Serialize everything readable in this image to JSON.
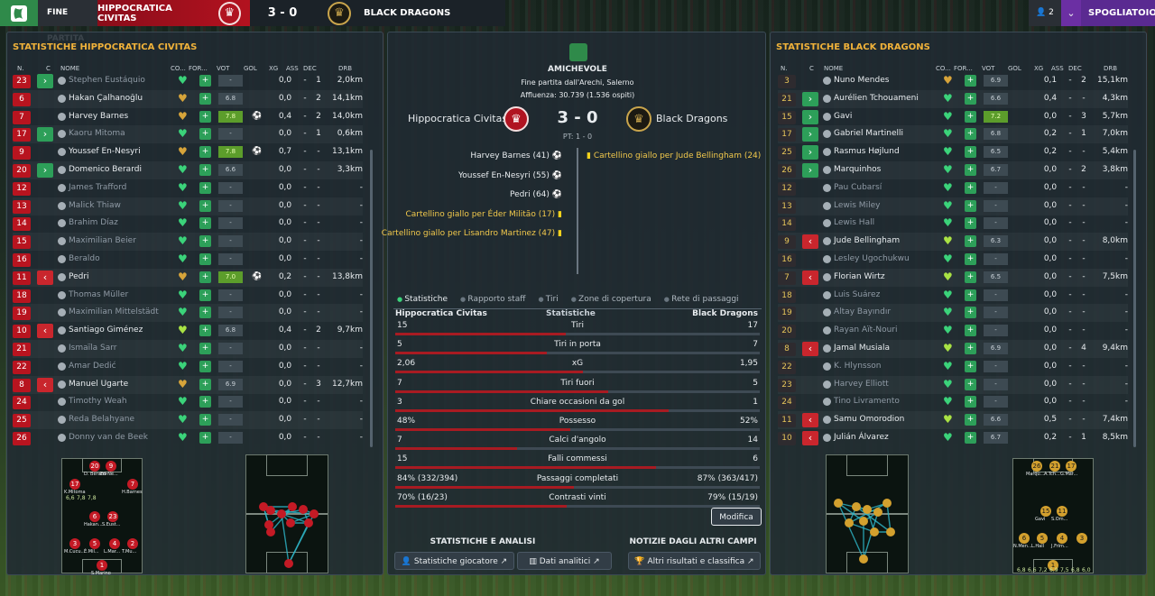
{
  "topbar": {
    "status": "FINE PARTITA",
    "home_team": "HIPPOCRATICA CIVITAS",
    "score": "3 - 0",
    "away_team": "BLACK DRAGONS",
    "notif_count": "2",
    "dressing_room": "SPOGLIATOIO"
  },
  "home": {
    "title": "STATISTICHE HIPPOCRATICA CIVITAS",
    "headers": {
      "n": "N.",
      "c": "C",
      "nome": "NOME",
      "co": "CO...",
      "for": "FOR...",
      "vot": "VOT",
      "gol": "GOL",
      "xg": "XG",
      "ass": "ASS",
      "dec": "DEC",
      "drb": "DRB"
    },
    "players": [
      {
        "n": "23",
        "sub": "in",
        "name": "Stephen Eustáquio",
        "cond": "green",
        "vot": "-",
        "goal": "",
        "xg": "0,0",
        "ass": "-",
        "dec": "1",
        "drb": "2,0km"
      },
      {
        "n": "6",
        "sub": "",
        "name": "Hakan Çalhanoğlu",
        "cond": "gold",
        "vot": "6.8",
        "goal": "",
        "xg": "0,0",
        "ass": "-",
        "dec": "2",
        "drb": "14,1km"
      },
      {
        "n": "7",
        "sub": "",
        "name": "Harvey Barnes",
        "cond": "gold",
        "vot": "7.8",
        "goal": "⚽",
        "xg": "0,4",
        "ass": "-",
        "dec": "2",
        "drb": "14,0km"
      },
      {
        "n": "17",
        "sub": "in",
        "name": "Kaoru Mitoma",
        "cond": "green",
        "vot": "-",
        "goal": "",
        "xg": "0,0",
        "ass": "-",
        "dec": "1",
        "drb": "0,6km"
      },
      {
        "n": "9",
        "sub": "",
        "name": "Youssef En-Nesyri",
        "cond": "gold",
        "vot": "7.8",
        "goal": "⚽",
        "xg": "0,7",
        "ass": "-",
        "dec": "-",
        "drb": "13,1km"
      },
      {
        "n": "20",
        "sub": "in",
        "name": "Domenico Berardi",
        "cond": "green",
        "vot": "6.6",
        "goal": "",
        "xg": "0,0",
        "ass": "-",
        "dec": "-",
        "drb": "3,3km"
      },
      {
        "n": "12",
        "sub": "",
        "name": "James Trafford",
        "cond": "green",
        "vot": "-",
        "goal": "",
        "xg": "0,0",
        "ass": "-",
        "dec": "-",
        "drb": "-"
      },
      {
        "n": "13",
        "sub": "",
        "name": "Malick Thiaw",
        "cond": "green",
        "vot": "-",
        "goal": "",
        "xg": "0,0",
        "ass": "-",
        "dec": "-",
        "drb": "-"
      },
      {
        "n": "14",
        "sub": "",
        "name": "Brahim Díaz",
        "cond": "green",
        "vot": "-",
        "goal": "",
        "xg": "0,0",
        "ass": "-",
        "dec": "-",
        "drb": "-"
      },
      {
        "n": "15",
        "sub": "",
        "name": "Maximilian Beier",
        "cond": "green",
        "vot": "-",
        "goal": "",
        "xg": "0,0",
        "ass": "-",
        "dec": "-",
        "drb": "-"
      },
      {
        "n": "16",
        "sub": "",
        "name": "Beraldo",
        "cond": "green",
        "vot": "-",
        "goal": "",
        "xg": "0,0",
        "ass": "-",
        "dec": "-",
        "drb": "-"
      },
      {
        "n": "11",
        "sub": "out",
        "name": "Pedri",
        "cond": "gold",
        "vot": "7.0",
        "goal": "⚽",
        "xg": "0,2",
        "ass": "-",
        "dec": "-",
        "drb": "13,8km"
      },
      {
        "n": "18",
        "sub": "",
        "name": "Thomas Müller",
        "cond": "green",
        "vot": "-",
        "goal": "",
        "xg": "0,0",
        "ass": "-",
        "dec": "-",
        "drb": "-"
      },
      {
        "n": "19",
        "sub": "",
        "name": "Maximilian Mittelstädt",
        "cond": "green",
        "vot": "-",
        "goal": "",
        "xg": "0,0",
        "ass": "-",
        "dec": "-",
        "drb": "-"
      },
      {
        "n": "10",
        "sub": "out",
        "name": "Santiago Giménez",
        "cond": "lime",
        "vot": "6.8",
        "goal": "",
        "xg": "0,4",
        "ass": "-",
        "dec": "2",
        "drb": "9,7km"
      },
      {
        "n": "21",
        "sub": "",
        "name": "Ismaïla Sarr",
        "cond": "green",
        "vot": "-",
        "goal": "",
        "xg": "0,0",
        "ass": "-",
        "dec": "-",
        "drb": "-"
      },
      {
        "n": "22",
        "sub": "",
        "name": "Amar Dedić",
        "cond": "green",
        "vot": "-",
        "goal": "",
        "xg": "0,0",
        "ass": "-",
        "dec": "-",
        "drb": "-"
      },
      {
        "n": "8",
        "sub": "out",
        "name": "Manuel Ugarte",
        "cond": "gold",
        "vot": "6.9",
        "goal": "",
        "xg": "0,0",
        "ass": "-",
        "dec": "3",
        "drb": "12,7km"
      },
      {
        "n": "24",
        "sub": "",
        "name": "Timothy Weah",
        "cond": "green",
        "vot": "-",
        "goal": "",
        "xg": "0,0",
        "ass": "-",
        "dec": "-",
        "drb": "-"
      },
      {
        "n": "25",
        "sub": "",
        "name": "Reda Belahyane",
        "cond": "green",
        "vot": "-",
        "goal": "",
        "xg": "0,0",
        "ass": "-",
        "dec": "-",
        "drb": "-"
      },
      {
        "n": "26",
        "sub": "",
        "name": "Donny van de Beek",
        "cond": "green",
        "vot": "-",
        "goal": "",
        "xg": "0,0",
        "ass": "-",
        "dec": "-",
        "drb": "-"
      }
    ]
  },
  "away": {
    "title": "STATISTICHE BLACK DRAGONS",
    "headers": {
      "n": "N.",
      "c": "C",
      "nome": "NOME",
      "co": "CO...",
      "for": "FOR...",
      "vot": "VOT",
      "gol": "GOL",
      "xg": "XG",
      "ass": "ASS",
      "dec": "DEC",
      "drb": "DRB"
    },
    "players": [
      {
        "n": "3",
        "sub": "",
        "name": "Nuno Mendes",
        "cond": "gold",
        "vot": "6.9",
        "goal": "",
        "xg": "0,1",
        "ass": "-",
        "dec": "2",
        "drb": "15,1km"
      },
      {
        "n": "21",
        "sub": "in",
        "name": "Aurélien Tchouameni",
        "cond": "green",
        "vot": "6.6",
        "goal": "",
        "xg": "0,4",
        "ass": "-",
        "dec": "-",
        "drb": "4,3km"
      },
      {
        "n": "15",
        "sub": "in",
        "name": "Gavi",
        "cond": "green",
        "vot": "7.2",
        "goal": "",
        "xg": "0,0",
        "ass": "-",
        "dec": "3",
        "drb": "5,7km"
      },
      {
        "n": "17",
        "sub": "in",
        "name": "Gabriel Martinelli",
        "cond": "green",
        "vot": "6.8",
        "goal": "",
        "xg": "0,2",
        "ass": "-",
        "dec": "1",
        "drb": "7,0km"
      },
      {
        "n": "25",
        "sub": "in",
        "name": "Rasmus Højlund",
        "cond": "green",
        "vot": "6.5",
        "goal": "",
        "xg": "0,2",
        "ass": "-",
        "dec": "-",
        "drb": "5,4km"
      },
      {
        "n": "26",
        "sub": "in",
        "name": "Marquinhos",
        "cond": "green",
        "vot": "6.7",
        "goal": "",
        "xg": "0,0",
        "ass": "-",
        "dec": "2",
        "drb": "3,8km"
      },
      {
        "n": "12",
        "sub": "",
        "name": "Pau Cubarsí",
        "cond": "green",
        "vot": "-",
        "goal": "",
        "xg": "0,0",
        "ass": "-",
        "dec": "-",
        "drb": "-"
      },
      {
        "n": "13",
        "sub": "",
        "name": "Lewis Miley",
        "cond": "green",
        "vot": "-",
        "goal": "",
        "xg": "0,0",
        "ass": "-",
        "dec": "-",
        "drb": "-"
      },
      {
        "n": "14",
        "sub": "",
        "name": "Lewis Hall",
        "cond": "green",
        "vot": "-",
        "goal": "",
        "xg": "0,0",
        "ass": "-",
        "dec": "-",
        "drb": "-"
      },
      {
        "n": "9",
        "sub": "out",
        "name": "Jude Bellingham",
        "cond": "lime",
        "vot": "6.3",
        "goal": "",
        "xg": "0,0",
        "ass": "-",
        "dec": "-",
        "drb": "8,0km"
      },
      {
        "n": "16",
        "sub": "",
        "name": "Lesley Ugochukwu",
        "cond": "green",
        "vot": "-",
        "goal": "",
        "xg": "0,0",
        "ass": "-",
        "dec": "-",
        "drb": "-"
      },
      {
        "n": "7",
        "sub": "out",
        "name": "Florian Wirtz",
        "cond": "lime",
        "vot": "6.5",
        "goal": "",
        "xg": "0,0",
        "ass": "-",
        "dec": "-",
        "drb": "7,5km"
      },
      {
        "n": "18",
        "sub": "",
        "name": "Luis Suárez",
        "cond": "green",
        "vot": "-",
        "goal": "",
        "xg": "0,0",
        "ass": "-",
        "dec": "-",
        "drb": "-"
      },
      {
        "n": "19",
        "sub": "",
        "name": "Altay Bayındır",
        "cond": "green",
        "vot": "-",
        "goal": "",
        "xg": "0,0",
        "ass": "-",
        "dec": "-",
        "drb": "-"
      },
      {
        "n": "20",
        "sub": "",
        "name": "Rayan Aït-Nouri",
        "cond": "green",
        "vot": "-",
        "goal": "",
        "xg": "0,0",
        "ass": "-",
        "dec": "-",
        "drb": "-"
      },
      {
        "n": "8",
        "sub": "out",
        "name": "Jamal Musiala",
        "cond": "lime",
        "vot": "6.9",
        "goal": "",
        "xg": "0,0",
        "ass": "-",
        "dec": "4",
        "drb": "9,4km"
      },
      {
        "n": "22",
        "sub": "",
        "name": "K. Hlynsson",
        "cond": "green",
        "vot": "-",
        "goal": "",
        "xg": "0,0",
        "ass": "-",
        "dec": "-",
        "drb": "-"
      },
      {
        "n": "23",
        "sub": "",
        "name": "Harvey Elliott",
        "cond": "green",
        "vot": "-",
        "goal": "",
        "xg": "0,0",
        "ass": "-",
        "dec": "-",
        "drb": "-"
      },
      {
        "n": "24",
        "sub": "",
        "name": "Tino Livramento",
        "cond": "green",
        "vot": "-",
        "goal": "",
        "xg": "0,0",
        "ass": "-",
        "dec": "-",
        "drb": "-"
      },
      {
        "n": "11",
        "sub": "out",
        "name": "Samu Omorodion",
        "cond": "lime",
        "vot": "6.6",
        "goal": "",
        "xg": "0,5",
        "ass": "-",
        "dec": "-",
        "drb": "7,4km"
      },
      {
        "n": "10",
        "sub": "out",
        "name": "Julián Álvarez",
        "cond": "green",
        "vot": "6.7",
        "goal": "",
        "xg": "0,2",
        "ass": "-",
        "dec": "1",
        "drb": "8,5km"
      }
    ]
  },
  "match": {
    "competition": "AMICHEVOLE",
    "stadium": "Fine partita dall'Arechi, Salerno",
    "attendance": "Affluenza: 30.739 (1.536 ospiti)",
    "home": "Hippocratica Civitas",
    "away": "Black Dragons",
    "score": "3 - 0",
    "halftime": "PT: 1 - 0",
    "home_events": [
      {
        "text": "Harvey Barnes (41)",
        "type": "goal"
      },
      {
        "text": "Youssef En-Nesyri (55)",
        "type": "goal"
      },
      {
        "text": "Pedri (64)",
        "type": "goal"
      },
      {
        "text": "Cartellino giallo per Éder Militão (17)",
        "type": "yellow"
      },
      {
        "text": "Cartellino giallo per Lisandro Martinez (47)",
        "type": "yellow"
      }
    ],
    "away_events": [
      {
        "text": "Cartellino giallo per Jude Bellingham (24)",
        "type": "yellow"
      }
    ]
  },
  "tabs": [
    "Statistiche",
    "Rapporto staff",
    "Tiri",
    "Zone di copertura",
    "Rete di passaggi"
  ],
  "stats_header": {
    "home": "Hippocratica Civitas",
    "mid": "Statistiche",
    "away": "Black Dragons"
  },
  "stats": [
    {
      "label": "Tiri",
      "home": "15",
      "away": "17",
      "hv": 15,
      "av": 17
    },
    {
      "label": "Tiri in porta",
      "home": "5",
      "away": "7",
      "hv": 5,
      "av": 7
    },
    {
      "label": "xG",
      "home": "2,06",
      "away": "1,95",
      "hv": 2.06,
      "av": 1.95
    },
    {
      "label": "Tiri fuori",
      "home": "7",
      "away": "5",
      "hv": 7,
      "av": 5
    },
    {
      "label": "Chiare occasioni da gol",
      "home": "3",
      "away": "1",
      "hv": 3,
      "av": 1
    },
    {
      "label": "Possesso",
      "home": "48%",
      "away": "52%",
      "hv": 48,
      "av": 52
    },
    {
      "label": "Calci d'angolo",
      "home": "7",
      "away": "14",
      "hv": 7,
      "av": 14
    },
    {
      "label": "Falli commessi",
      "home": "15",
      "away": "6",
      "hv": 15,
      "av": 6
    },
    {
      "label": "Passaggi completati",
      "home": "84% (332/394)",
      "away": "87% (363/417)",
      "hv": 84,
      "av": 87
    },
    {
      "label": "Contrasti vinti",
      "home": "70% (16/23)",
      "away": "79% (15/19)",
      "hv": 70,
      "av": 79
    }
  ],
  "modify_label": "Modifica",
  "bottom": {
    "left_title": "STATISTICHE E ANALISI",
    "right_title": "NOTIZIE DAGLI ALTRI CAMPI",
    "btn_player_stats": "Statistiche giocatore",
    "btn_analytics": "Dati analitici",
    "btn_other_results": "Altri risultati e classifica"
  },
  "home_formation": [
    {
      "n": "20",
      "label": "D. Berardi"
    },
    {
      "n": "9",
      "label": "En-Ne..."
    },
    {
      "n": "17",
      "label": "K.Mitoma"
    },
    {
      "n": "7",
      "label": "H.Barnes"
    },
    {
      "n": "6",
      "label": "Hakan..."
    },
    {
      "n": "23",
      "label": "S.Eust..."
    },
    {
      "n": "3",
      "label": "M.Cucu..."
    },
    {
      "n": "5",
      "label": "É.Mil..."
    },
    {
      "n": "4",
      "label": "L.Mar..."
    },
    {
      "n": "2",
      "label": "T.Mu..."
    },
    {
      "n": "1",
      "label": "S.Marino"
    }
  ],
  "home_formation_ratings": [
    "6,6",
    "7,8",
    "7,8"
  ],
  "away_formation": [
    {
      "n": "26",
      "label": "Marqu..."
    },
    {
      "n": "21",
      "label": "A.Tch..."
    },
    {
      "n": "17",
      "label": "G.Mar..."
    },
    {
      "n": "15",
      "label": "Gavi"
    },
    {
      "n": "11",
      "label": "S.Om..."
    },
    {
      "n": "6",
      "label": "N.Men..."
    },
    {
      "n": "5",
      "label": "L.Hall"
    },
    {
      "n": "4",
      "label": "J.Frim..."
    },
    {
      "n": "3",
      "label": ""
    },
    {
      "n": "1",
      "label": ""
    }
  ],
  "away_formation_ratings": [
    "6,8",
    "6,6",
    "7,2",
    "6,9",
    "7,5",
    "6,8",
    "6,0"
  ]
}
